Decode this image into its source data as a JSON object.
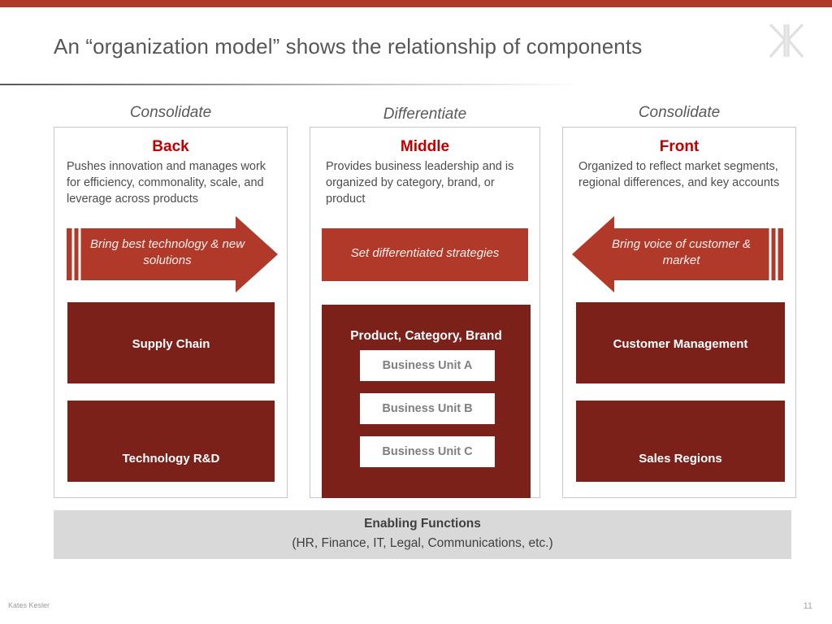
{
  "theme": {
    "accent_bar": "#b03a2a",
    "arrow_red": "#b1392a",
    "block_maroon": "#7c211a",
    "heading_red": "#c00000",
    "band_gray": "#d9d9d9"
  },
  "header": {
    "title": "An “organization model” shows the relationship of components",
    "logo_alt": "kates-kesler-logo"
  },
  "columns": [
    {
      "band_label": "Consolidate",
      "title": "Back",
      "description": "Pushes innovation and manages work for efficiency, commonality, scale, and leverage across products",
      "arrow": {
        "direction": "right",
        "text": "Bring best technology & new solutions"
      },
      "blocks": [
        {
          "label": "Supply Chain"
        },
        {
          "label": "Technology R&D"
        }
      ]
    },
    {
      "band_label": "Differentiate",
      "title": "Middle",
      "description": "Provides business leadership and is organized by category, brand, or product",
      "arrow": {
        "direction": "none",
        "text": "Set differentiated strategies"
      },
      "blocks": [
        {
          "label": "Product, Category, Brand",
          "children": [
            {
              "label": "Business Unit A"
            },
            {
              "label": "Business Unit B"
            },
            {
              "label": "Business Unit C"
            }
          ]
        }
      ]
    },
    {
      "band_label": "Consolidate",
      "title": "Front",
      "description": "Organized to reflect market segments, regional differences, and key accounts",
      "arrow": {
        "direction": "left",
        "text": "Bring voice of customer & market"
      },
      "blocks": [
        {
          "label": "Customer Management"
        },
        {
          "label": "Sales Regions"
        }
      ]
    }
  ],
  "enabling": {
    "line1": "Enabling Functions",
    "line2": "(HR, Finance, IT, Legal, Communications, etc.)"
  },
  "footer": {
    "brand": "Kates Kesler",
    "page_number": "11"
  }
}
